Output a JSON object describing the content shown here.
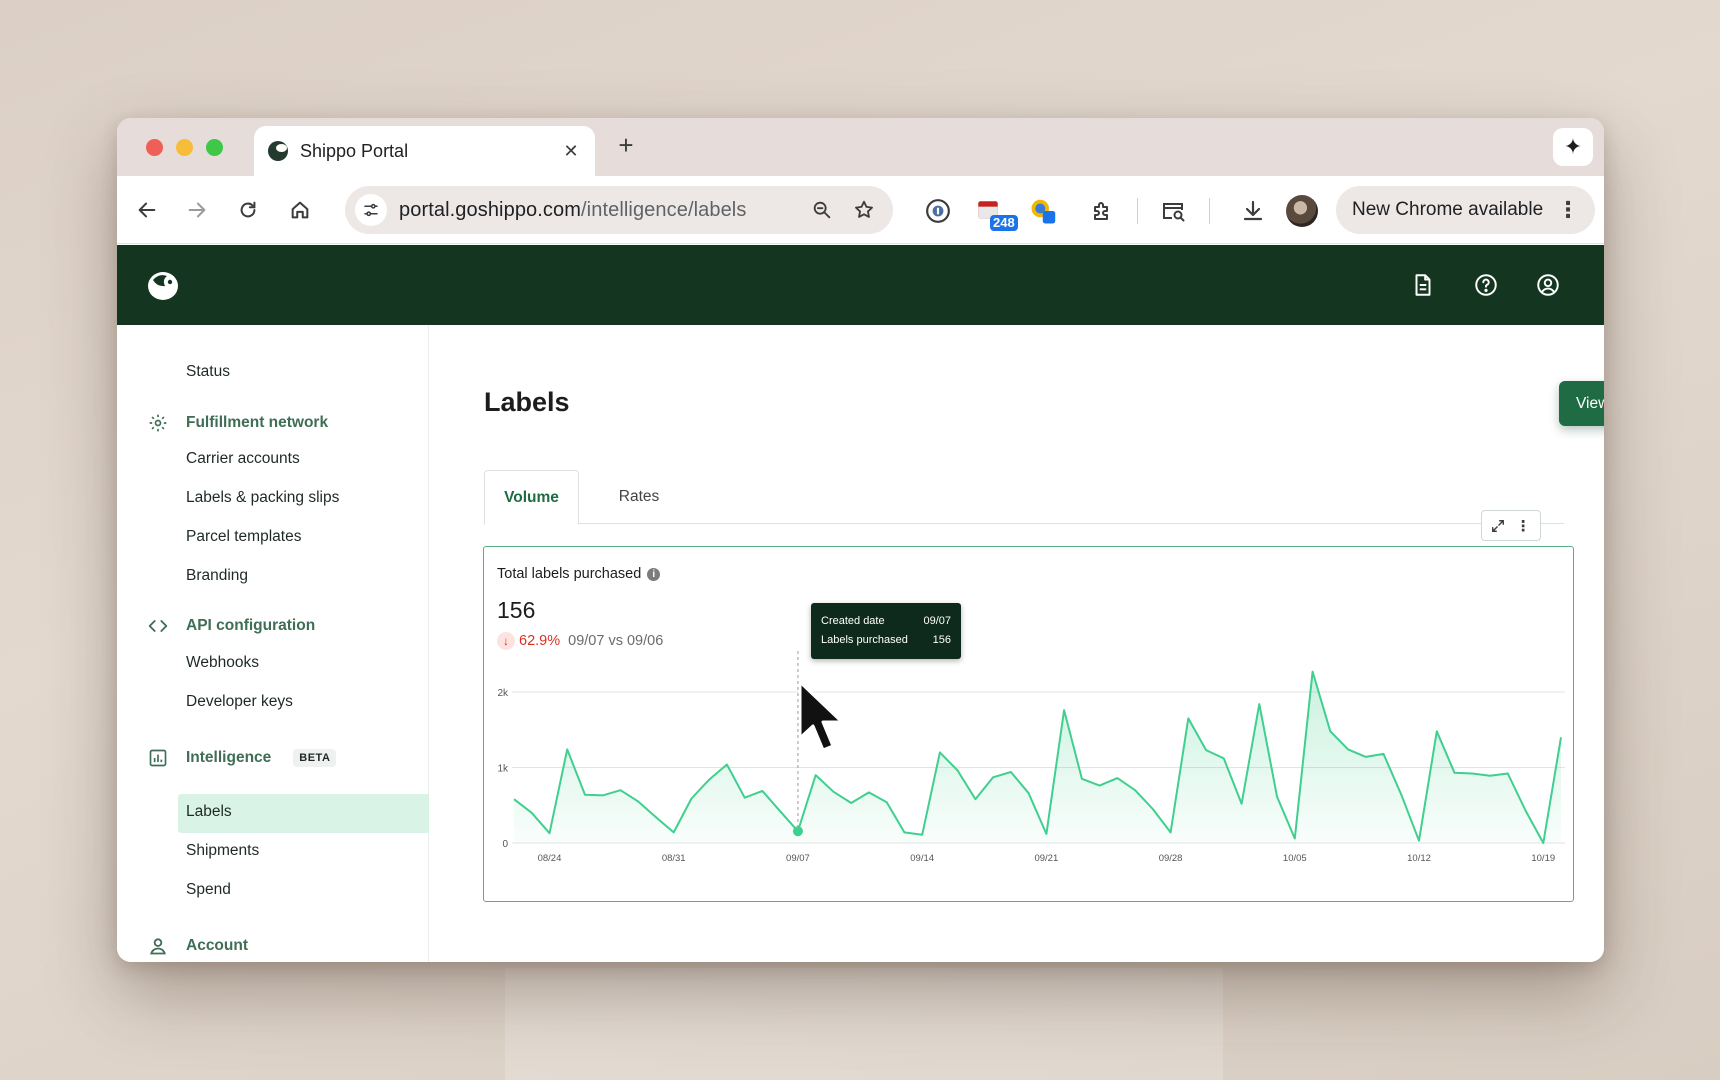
{
  "browser": {
    "tab_title": "Shippo Portal",
    "url_host": "portal.goshippo.com",
    "url_path": "/intelligence/labels",
    "extension_badge": "248",
    "update_label": "New Chrome available"
  },
  "sidebar": {
    "items": [
      {
        "label": "Status"
      },
      {
        "label": "Fulfillment network",
        "group": true,
        "icon": "gear-icon"
      },
      {
        "label": "Carrier accounts"
      },
      {
        "label": "Labels & packing slips"
      },
      {
        "label": "Parcel templates"
      },
      {
        "label": "Branding"
      },
      {
        "label": "API configuration",
        "group": true,
        "icon": "code-icon"
      },
      {
        "label": "Webhooks"
      },
      {
        "label": "Developer keys"
      },
      {
        "label": "Intelligence",
        "group": true,
        "icon": "chart-icon",
        "badge": "BETA"
      },
      {
        "label": "Labels",
        "active": true
      },
      {
        "label": "Shipments"
      },
      {
        "label": "Spend"
      },
      {
        "label": "Account",
        "group": true,
        "icon": "person-icon"
      }
    ]
  },
  "page": {
    "title": "Labels",
    "view_raw_label": "View raw data",
    "tabs": [
      {
        "label": "Volume",
        "active": true
      },
      {
        "label": "Rates"
      }
    ]
  },
  "metric": {
    "title": "Total labels purchased",
    "value": "156",
    "delta_pct": "62.9%",
    "delta_compare": "09/07 vs 09/06",
    "delta_direction": "down"
  },
  "tooltip": {
    "rows": [
      {
        "label": "Created date",
        "value": "09/07"
      },
      {
        "label": "Labels purchased",
        "value": "156"
      }
    ]
  },
  "colors": {
    "header_bg": "#143621",
    "accent": "#1f6b44",
    "series": "#3fcf8e",
    "active_nav_bg": "#d9f3e7",
    "negative": "#d93025"
  },
  "chart_data": {
    "type": "area",
    "ylim": [
      0,
      2000
    ],
    "y_ticks": [
      0,
      1000,
      2000
    ],
    "y_tick_labels": [
      "0",
      "1k",
      "2k"
    ],
    "x_tick_labels": [
      "08/24",
      "08/31",
      "09/07",
      "09/14",
      "09/21",
      "09/28",
      "10/05",
      "10/12",
      "10/19"
    ],
    "x_tick_index": [
      2,
      9,
      16,
      23,
      30,
      37,
      44,
      51,
      58
    ],
    "grid": true,
    "highlight_index": 16,
    "series": [
      {
        "values": [
          580,
          400,
          130,
          1240,
          640,
          630,
          700,
          550,
          340,
          140,
          590,
          840,
          1040,
          600,
          690,
          420,
          156,
          900,
          680,
          530,
          670,
          540,
          140,
          110,
          1200,
          960,
          580,
          870,
          940,
          660,
          120,
          1760,
          850,
          760,
          860,
          700,
          450,
          140,
          1650,
          1230,
          1120,
          520,
          1840,
          610,
          60,
          2270,
          1480,
          1240,
          1140,
          1180,
          640,
          30,
          1480,
          930,
          920,
          890,
          920,
          430,
          0,
          1400
        ]
      }
    ]
  }
}
